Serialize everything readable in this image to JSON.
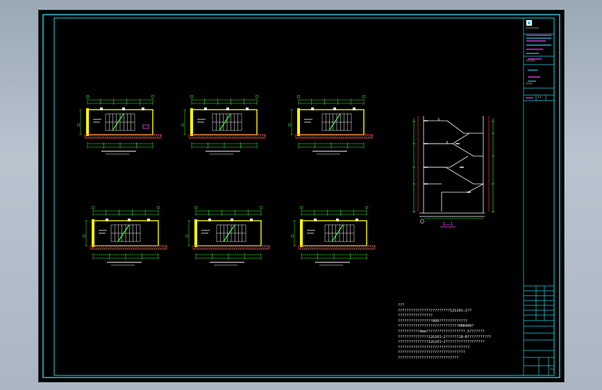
{
  "section_title": "1—1",
  "notes": [
    "???",
    "????????????????????????12G101—2??",
    "????????????????",
    "????????????????800?????????????",
    "????????????????????????????HRB400?",
    "??????????4mm??????????????????.5???????",
    "??????????????12G101—2??????18—B???????????",
    "??????????????12G101—2??????????????????",
    "?????????????????????????????????",
    "???????????????????????????????",
    "????????????????????????????"
  ],
  "title_block": {
    "company": "??????????",
    "project": "???????",
    "drawing_title": "?????",
    "scale": "1:1",
    "sheet_no": "1:1"
  },
  "colors": {
    "frame": "#22d3e6",
    "wall_yellow": "#ffff00",
    "dim_green": "#3cff3c",
    "hatch_white": "#ffffff",
    "grid_red": "#ff3030",
    "accent_magenta": "#ff40ff"
  }
}
